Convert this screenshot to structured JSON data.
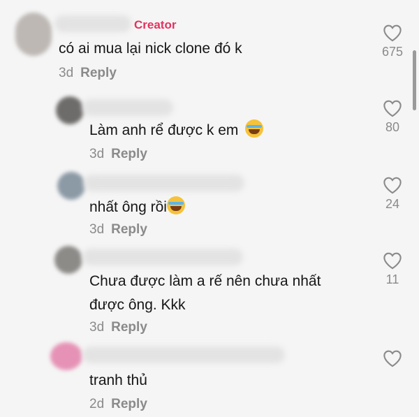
{
  "comments": [
    {
      "text": "có ai mua lại nick clone đó k",
      "time": "3d",
      "reply": "Reply",
      "likes": "675",
      "tag": "Creator",
      "emoji": ""
    },
    {
      "text": "Làm anh rể được k em",
      "time": "3d",
      "reply": "Reply",
      "likes": "80",
      "emoji": "laughing-with-tears-emoji"
    },
    {
      "text": "nhất ông rồi",
      "time": "3d",
      "reply": "Reply",
      "likes": "24",
      "emoji": "laughing-with-tears-emoji"
    },
    {
      "text": "Chưa được làm a rế nên chưa nhất",
      "text2": "được ông. Kkk",
      "time": "3d",
      "reply": "Reply",
      "likes": "11",
      "emoji": ""
    },
    {
      "text": "tranh thủ",
      "time": "2d",
      "reply": "Reply",
      "likes": "",
      "emoji": ""
    }
  ],
  "colors": {
    "creator": "#e3325f",
    "muted": "#8a8a8a",
    "text": "#161616",
    "background": "#f5f5f5"
  },
  "icons": {
    "like": "heart-outline-icon"
  }
}
